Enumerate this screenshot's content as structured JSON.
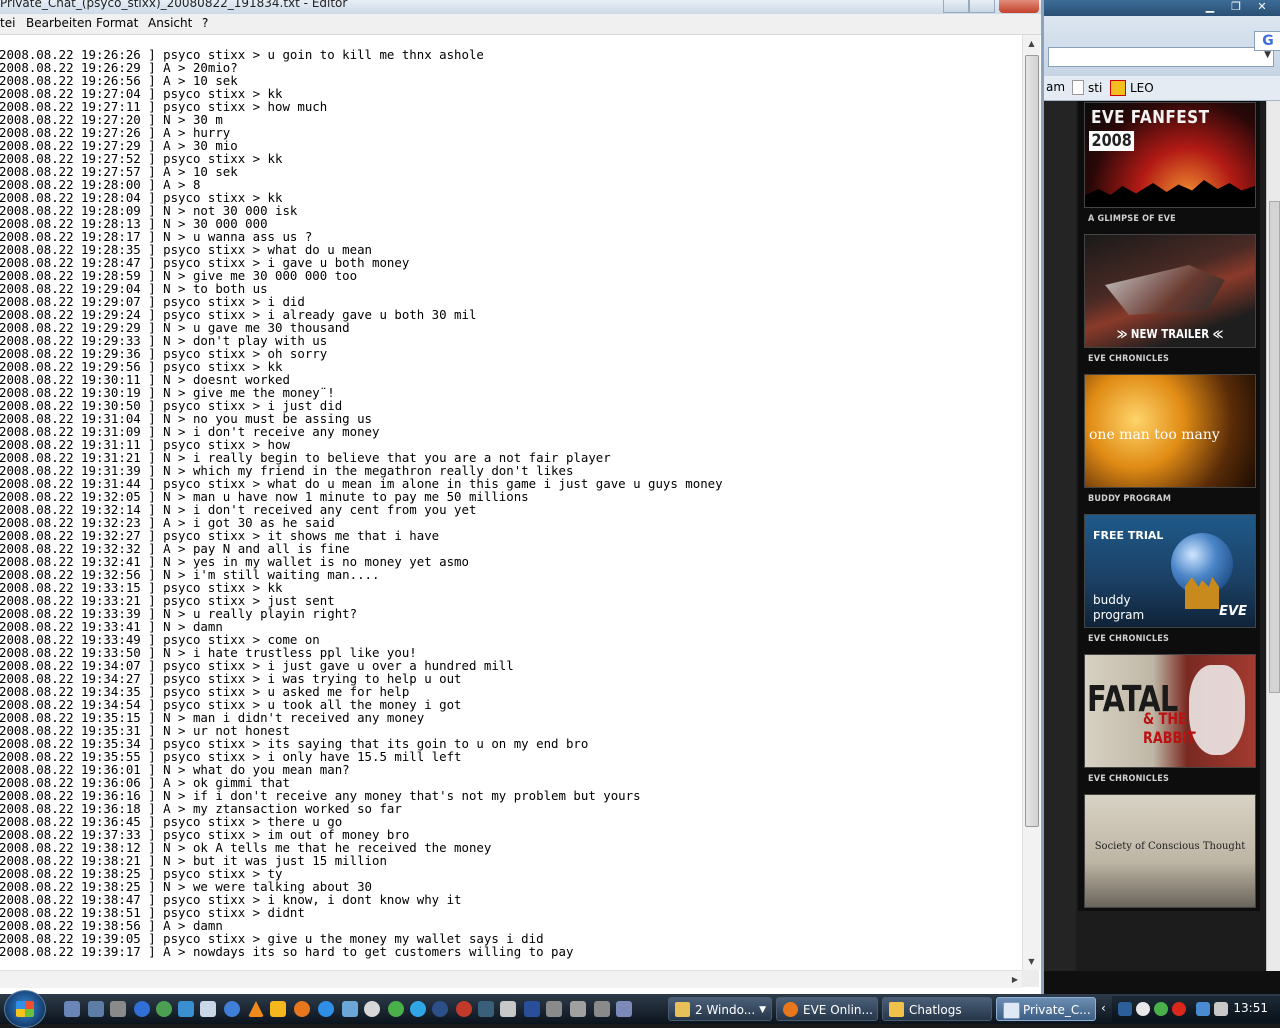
{
  "notepad": {
    "title": "Private_Chat_(psyco_stixx)_20080822_191834.txt - Editor",
    "menu": [
      "tei",
      "Bearbeiten",
      "Format",
      "Ansicht",
      "?"
    ],
    "lines": [
      "2008.08.22 19:26:26 ] psyco stixx > u goin to kill me thnx ashole",
      "2008.08.22 19:26:29 ] A > 20mio?",
      "2008.08.22 19:26:56 ] A > 10 sek",
      "2008.08.22 19:27:04 ] psyco stixx > kk",
      "2008.08.22 19:27:11 ] psyco stixx > how much",
      "2008.08.22 19:27:20 ] N > 30 m",
      "2008.08.22 19:27:26 ] A > hurry",
      "2008.08.22 19:27:29 ] A > 30 mio",
      "2008.08.22 19:27:52 ] psyco stixx > kk",
      "2008.08.22 19:27:57 ] A > 10 sek",
      "2008.08.22 19:28:00 ] A > 8",
      "2008.08.22 19:28:04 ] psyco stixx > kk",
      "2008.08.22 19:28:09 ] N > not 30 000 isk",
      "2008.08.22 19:28:13 ] N > 30 000 000",
      "2008.08.22 19:28:17 ] N > u wanna ass us ?",
      "2008.08.22 19:28:35 ] psyco stixx > what do u mean",
      "2008.08.22 19:28:47 ] psyco stixx > i gave u both money",
      "2008.08.22 19:28:59 ] N > give me 30 000 000 too",
      "2008.08.22 19:29:04 ] N > to both us",
      "2008.08.22 19:29:07 ] psyco stixx > i did",
      "2008.08.22 19:29:24 ] psyco stixx > i already gave u both 30 mil",
      "2008.08.22 19:29:29 ] N > u gave me 30 thousand",
      "2008.08.22 19:29:33 ] N > don't play with us",
      "2008.08.22 19:29:36 ] psyco stixx > oh sorry",
      "2008.08.22 19:29:56 ] psyco stixx > kk",
      "2008.08.22 19:30:11 ] N > doesnt worked",
      "2008.08.22 19:30:19 ] N > give me the money¨!",
      "2008.08.22 19:30:50 ] psyco stixx > i just did",
      "2008.08.22 19:31:04 ] N > no you must be assing us",
      "2008.08.22 19:31:09 ] N > i don't receive any money",
      "2008.08.22 19:31:11 ] psyco stixx > how",
      "2008.08.22 19:31:21 ] N > i really begin to believe that you are a not fair player",
      "2008.08.22 19:31:39 ] N > which my friend in the megathron really don't likes",
      "2008.08.22 19:31:44 ] psyco stixx > what do u mean im alone in this game i just gave u guys money",
      "2008.08.22 19:32:05 ] N > man u have now 1 minute to pay me 50 millions",
      "2008.08.22 19:32:14 ] N > i don't received any cent from you yet",
      "2008.08.22 19:32:23 ] A > i got 30 as he said",
      "2008.08.22 19:32:27 ] psyco stixx > it shows me that i have",
      "2008.08.22 19:32:32 ] A > pay N and all is fine",
      "2008.08.22 19:32:41 ] N > yes in my wallet is no money yet asmo",
      "2008.08.22 19:32:56 ] N > i'm still waiting man....",
      "2008.08.22 19:33:15 ] psyco stixx > kk",
      "2008.08.22 19:33:21 ] psyco stixx > just sent",
      "2008.08.22 19:33:39 ] N > u really playin right?",
      "2008.08.22 19:33:41 ] N > damn",
      "2008.08.22 19:33:49 ] psyco stixx > come on",
      "2008.08.22 19:33:50 ] N > i hate trustless ppl like you!",
      "2008.08.22 19:34:07 ] psyco stixx > i just gave u over a hundred mill",
      "2008.08.22 19:34:27 ] psyco stixx > i was trying to help u out",
      "2008.08.22 19:34:35 ] psyco stixx > u asked me for help",
      "2008.08.22 19:34:54 ] psyco stixx > u took all the money i got",
      "2008.08.22 19:35:15 ] N > man i didn't received any money",
      "2008.08.22 19:35:31 ] N > ur not honest",
      "2008.08.22 19:35:34 ] psyco stixx > its saying that its goin to u on my end bro",
      "2008.08.22 19:35:55 ] psyco stixx > i only have 15.5 mill left",
      "2008.08.22 19:36:01 ] N > what do you mean man?",
      "2008.08.22 19:36:06 ] A > ok gimmi that",
      "2008.08.22 19:36:16 ] N > if i don't receive any money that's not my problem but yours",
      "2008.08.22 19:36:18 ] A > my ztansaction worked so far",
      "2008.08.22 19:36:45 ] psyco stixx > there u go",
      "2008.08.22 19:37:33 ] psyco stixx > im out of money bro",
      "2008.08.22 19:38:12 ] N > ok A tells me that he received the money",
      "2008.08.22 19:38:21 ] N > but it was just 15 million",
      "2008.08.22 19:38:25 ] psyco stixx > ty",
      "2008.08.22 19:38:25 ] N > we were talking about 30",
      "2008.08.22 19:38:47 ] psyco stixx > i know, i dont know why it",
      "2008.08.22 19:38:51 ] psyco stixx > didnt",
      "2008.08.22 19:38:56 ] A > damn",
      "2008.08.22 19:39:05 ] psyco stixx > give u the money my wallet says i did",
      "2008.08.22 19:39:17 ] A > nowdays its so hard to get customers willing to pay"
    ]
  },
  "browser": {
    "bookmarks": [
      "am",
      "sti",
      "LEO"
    ],
    "search_glyph": "G",
    "sidebar": {
      "banner1_line1": "EVE FANFEST",
      "banner1_line2": "2008",
      "label1": "A GLIMPSE OF EVE",
      "banner2_caption": "≫ NEW TRAILER ≪",
      "label2": "EVE CHRONICLES",
      "banner3_caption": "one man too many",
      "label3": "BUDDY PROGRAM",
      "banner4_title": "FREE TRIAL",
      "banner4_line1": "buddy",
      "banner4_line2": "program",
      "banner4_logo": "EVE",
      "label4": "EVE CHRONICLES",
      "banner5_line1": "FATAL",
      "banner5_line2": "& THE RABBIT",
      "label5": "EVE CHRONICLES",
      "banner6_caption": "Society of Conscious Thought"
    }
  },
  "taskbar": {
    "tasks": [
      {
        "label": "2 Windo...",
        "active": false
      },
      {
        "label": "EVE Onlin...",
        "active": false
      },
      {
        "label": "Chatlogs",
        "active": false
      },
      {
        "label": "Private_C...",
        "active": true
      }
    ],
    "clock": "13:51",
    "colors": {
      "accent": "#3e5f85"
    }
  }
}
